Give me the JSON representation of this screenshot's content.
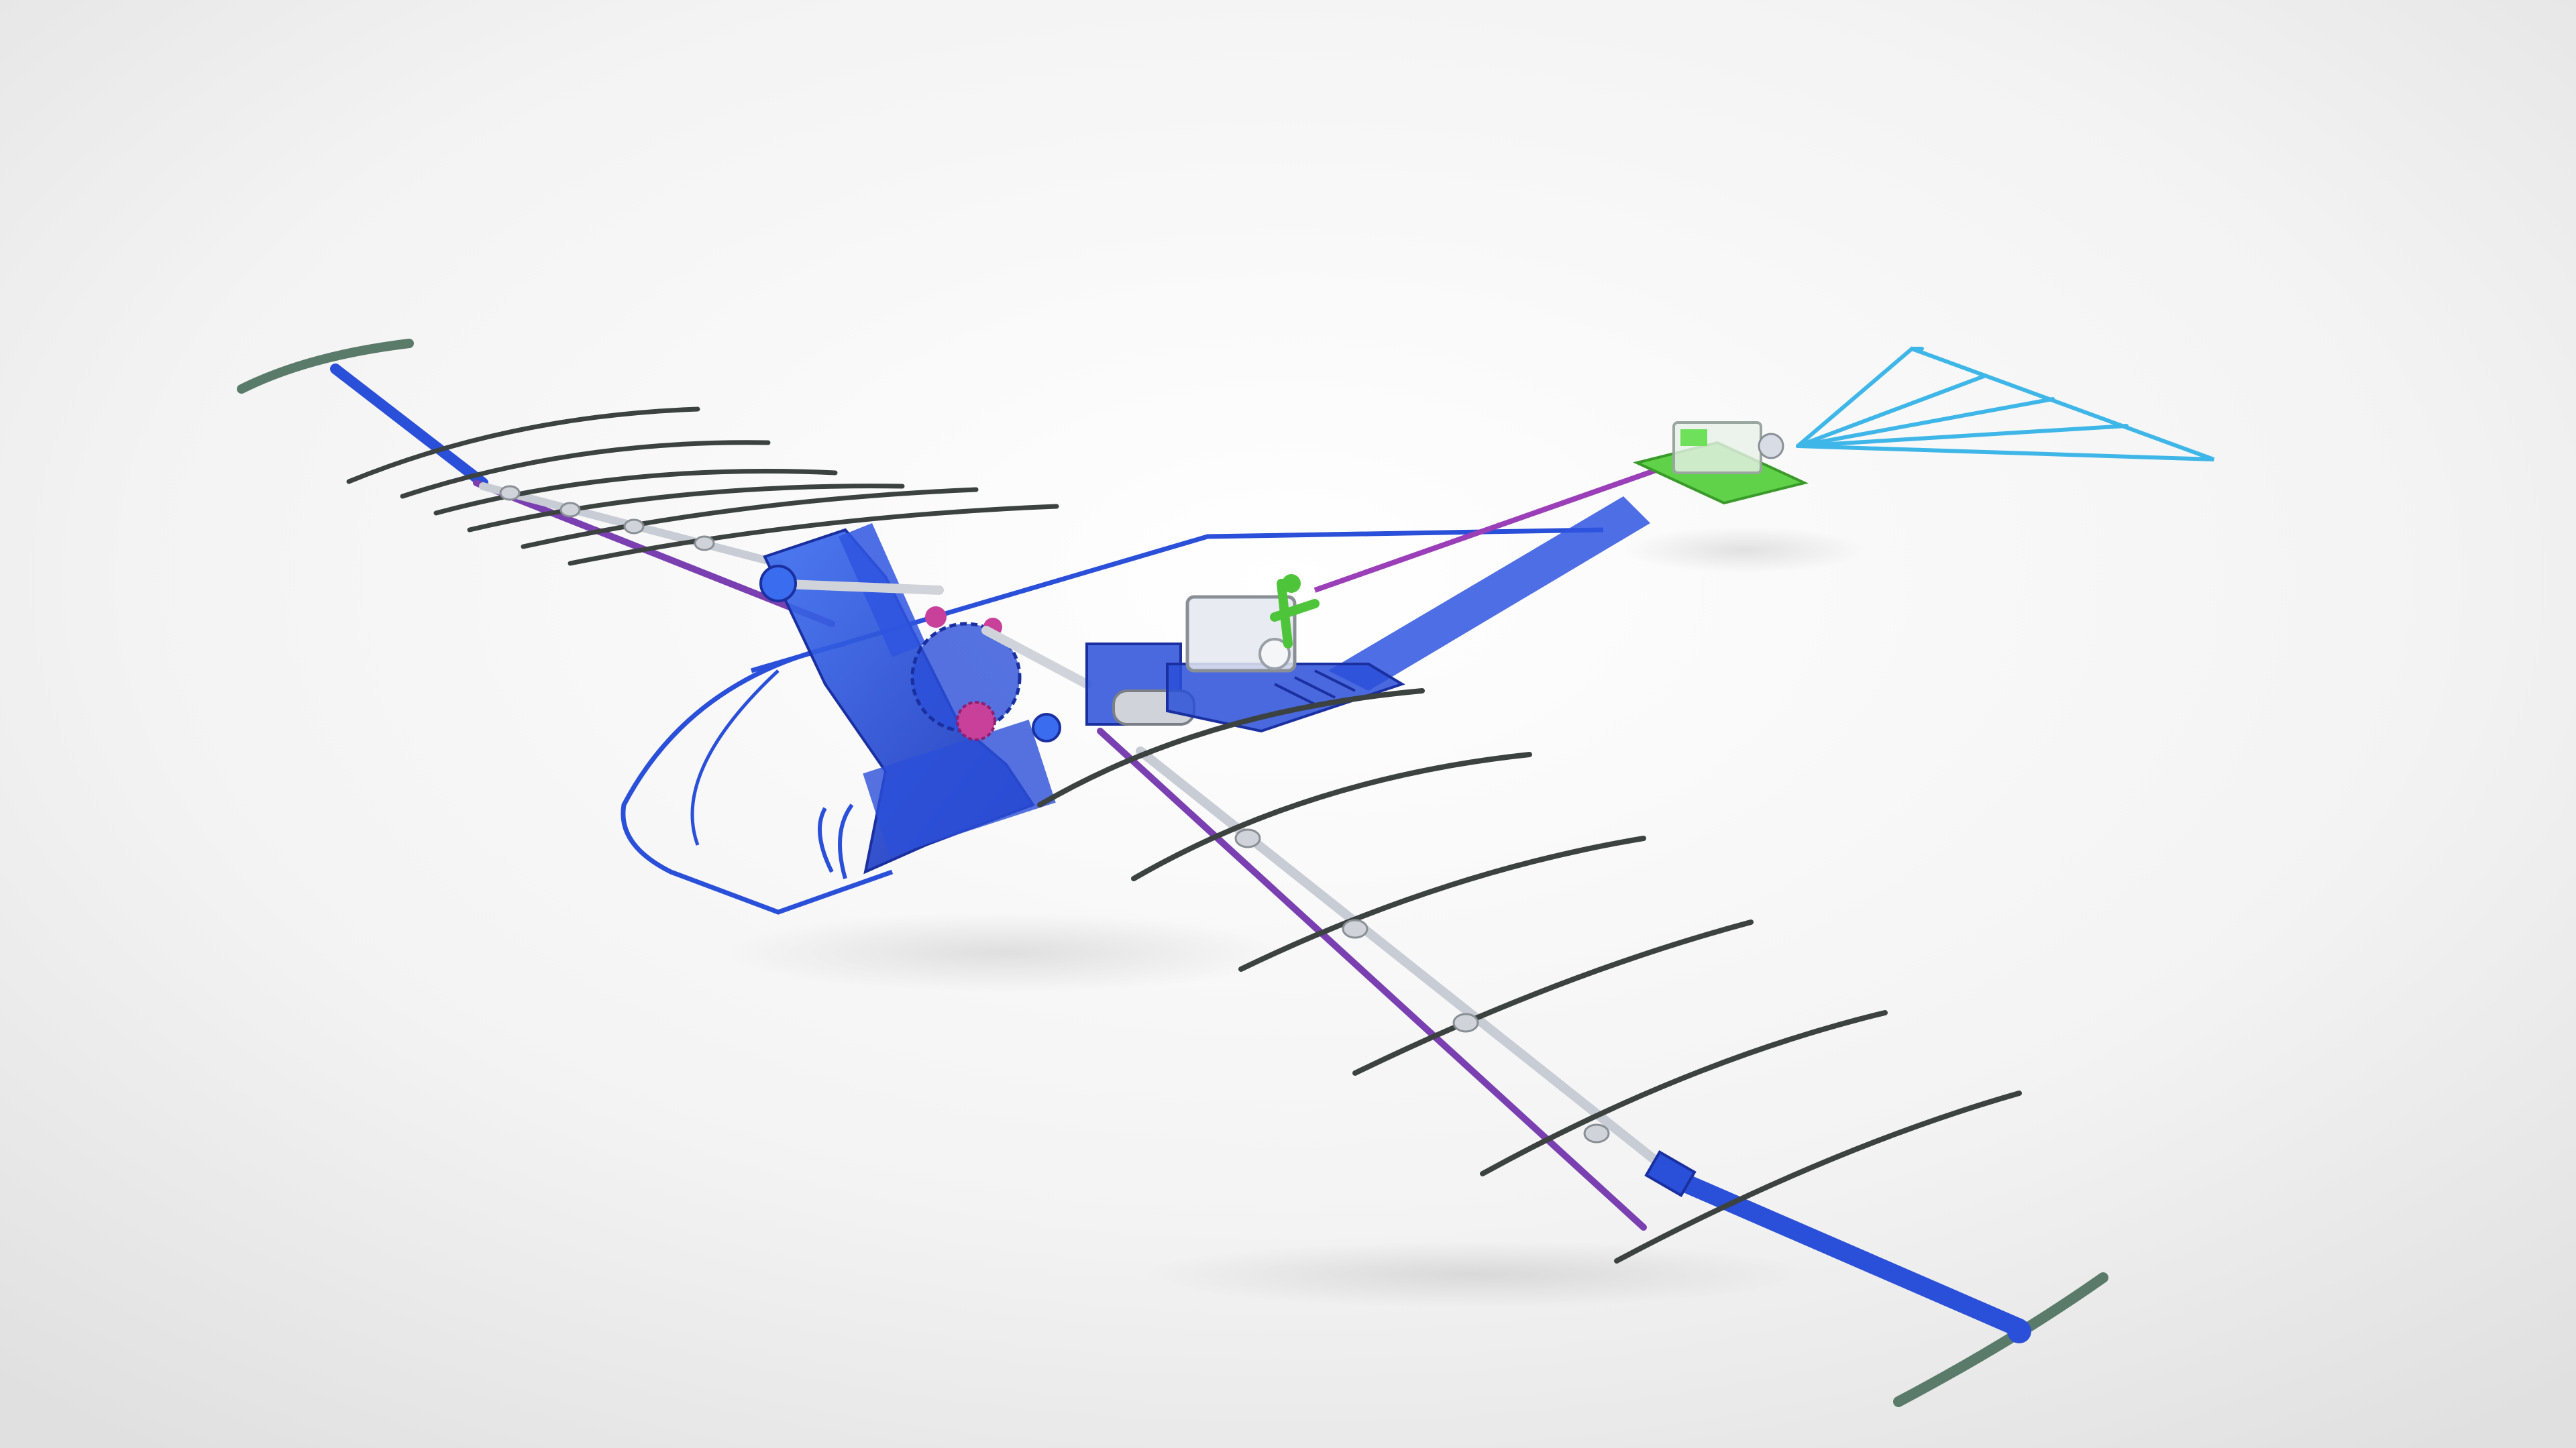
{
  "scene": {
    "subject": "ornithopter-model-render",
    "colors": {
      "background_center": "#ffffff",
      "background_edge": "#e2e2e2",
      "frame_blue": "#2a4fd8",
      "frame_blue_dark": "#1a2fa0",
      "spar_purple": "#7a3fb0",
      "rib_dark": "#3b4240",
      "rib_tip_green": "#5a7a6a",
      "rod_silver": "#c8ccd4",
      "tail_cyan": "#3fb6e8",
      "electronics_green": "#5fd24a",
      "gear_magenta": "#c8409a",
      "battery_clear": "#d8dce4"
    }
  }
}
